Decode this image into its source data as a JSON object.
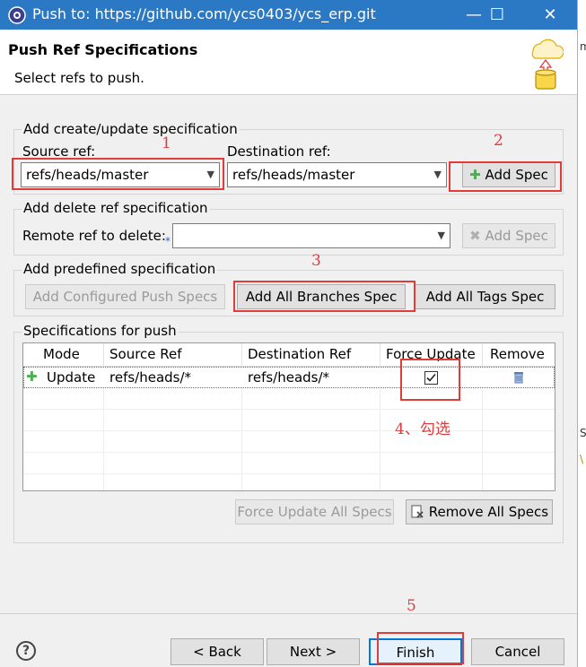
{
  "window": {
    "title": "Push to: https://github.com/ycs0403/ycs_erp.git",
    "min_glyph": "—",
    "max_glyph": "☐",
    "close_glyph": "✕"
  },
  "background_window": {
    "chars": [
      "m",
      "St",
      "\\"
    ]
  },
  "header": {
    "title": "Push Ref Specifications",
    "subtitle": "Select refs to push."
  },
  "create_update": {
    "group_label": "Add create/update specification",
    "source_label": "Source ref:",
    "source_value": "refs/heads/master",
    "dest_label": "Destination ref:",
    "dest_value": "refs/heads/master",
    "add_spec": "Add Spec"
  },
  "delete_spec": {
    "group_label": "Add delete ref specification",
    "remote_label": "Remote ref to delete:",
    "remote_value": "",
    "add_spec": "Add Spec"
  },
  "predefined": {
    "group_label": "Add predefined specification",
    "configured": "Add Configured Push Specs",
    "all_branches": "Add All Branches Spec",
    "all_tags": "Add All Tags Spec"
  },
  "specs": {
    "group_label": "Specifications for push",
    "columns": [
      "Mode",
      "Source Ref",
      "Destination Ref",
      "Force Update",
      "Remove"
    ],
    "rows": [
      {
        "mode": "Update",
        "source": "refs/heads/*",
        "dest": "refs/heads/*",
        "force": true
      }
    ],
    "force_all": "Force Update All Specs",
    "remove_all": "Remove All Specs"
  },
  "annotations": [
    "1",
    "2",
    "3",
    "4、勾选",
    "5"
  ],
  "footer": {
    "help": "?",
    "back": "< Back",
    "next": "Next >",
    "finish": "Finish",
    "cancel": "Cancel"
  },
  "colors": {
    "titlebar": "#2b78c5",
    "annotation_red": "#e23b3b",
    "add_green": "#4caf50"
  },
  "icons": [
    "eclipse-gear-icon",
    "cloud-push-icon",
    "add-plus-icon",
    "delete-x-icon",
    "trash-icon",
    "help-icon",
    "remove-all-icon"
  ]
}
